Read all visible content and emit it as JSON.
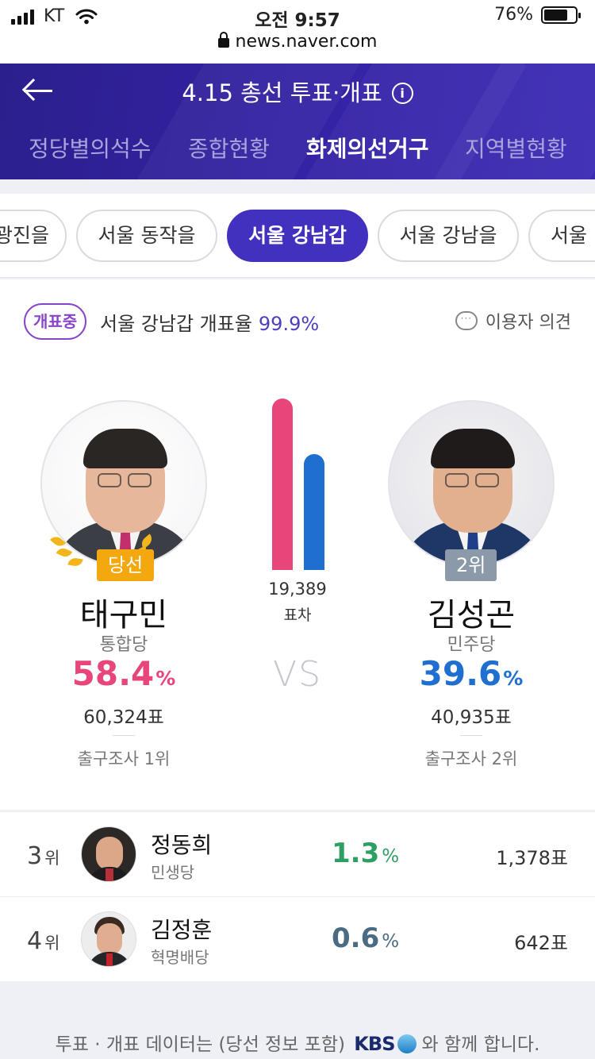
{
  "status": {
    "carrier": "KT",
    "time": "오전 9:57",
    "battery": "76%",
    "battery_level": 0.76,
    "url": "news.naver.com"
  },
  "header": {
    "title": "4.15 총선 투표·개표",
    "info_icon": "info-icon",
    "tabs": [
      {
        "label": "정당별의석수",
        "active": false
      },
      {
        "label": "종합현황",
        "active": false
      },
      {
        "label": "화제의선거구",
        "active": true
      },
      {
        "label": "지역별현황",
        "active": false
      }
    ]
  },
  "districts": [
    {
      "label": "광진을",
      "active": false
    },
    {
      "label": "서울 동작을",
      "active": false
    },
    {
      "label": "서울 강남갑",
      "active": true
    },
    {
      "label": "서울 강남을",
      "active": false
    },
    {
      "label": "서울 ",
      "active": false
    }
  ],
  "summary": {
    "badge": "개표중",
    "district_text": "서울 강남갑 개표율",
    "count_rate": "99.9%",
    "opinion": "이용자 의견"
  },
  "top": {
    "winner": {
      "tag": "당선",
      "name": "태구민",
      "party": "통합당",
      "pct": "58.4",
      "pct_value": 58.4,
      "pct_unit": "%",
      "votes": "60,324표",
      "exit_poll": "출구조사 1위",
      "color": "#e8457a"
    },
    "runner": {
      "tag": "2위",
      "name": "김성곤",
      "party": "민주당",
      "pct": "39.6",
      "pct_value": 39.6,
      "pct_unit": "%",
      "votes": "40,935표",
      "exit_poll": "출구조사 2위",
      "color": "#1f6fd1"
    },
    "margin": "19,389",
    "margin_label": "표차",
    "vs": "VS"
  },
  "others": [
    {
      "rank": "3",
      "rank_unit": "위",
      "name": "정동희",
      "party": "민생당",
      "pct": "1.3",
      "pct_unit": "%",
      "votes": "1,378표",
      "color": "#2f9e63"
    },
    {
      "rank": "4",
      "rank_unit": "위",
      "name": "김정훈",
      "party": "혁명배당",
      "pct": "0.6",
      "pct_unit": "%",
      "votes": "642표",
      "color": "#4a6b82"
    }
  ],
  "footer": {
    "text_before": "투표 · 개표 데이터는 (당선 정보 포함)",
    "brand": "KBS",
    "text_after": "와 함께 합니다."
  }
}
